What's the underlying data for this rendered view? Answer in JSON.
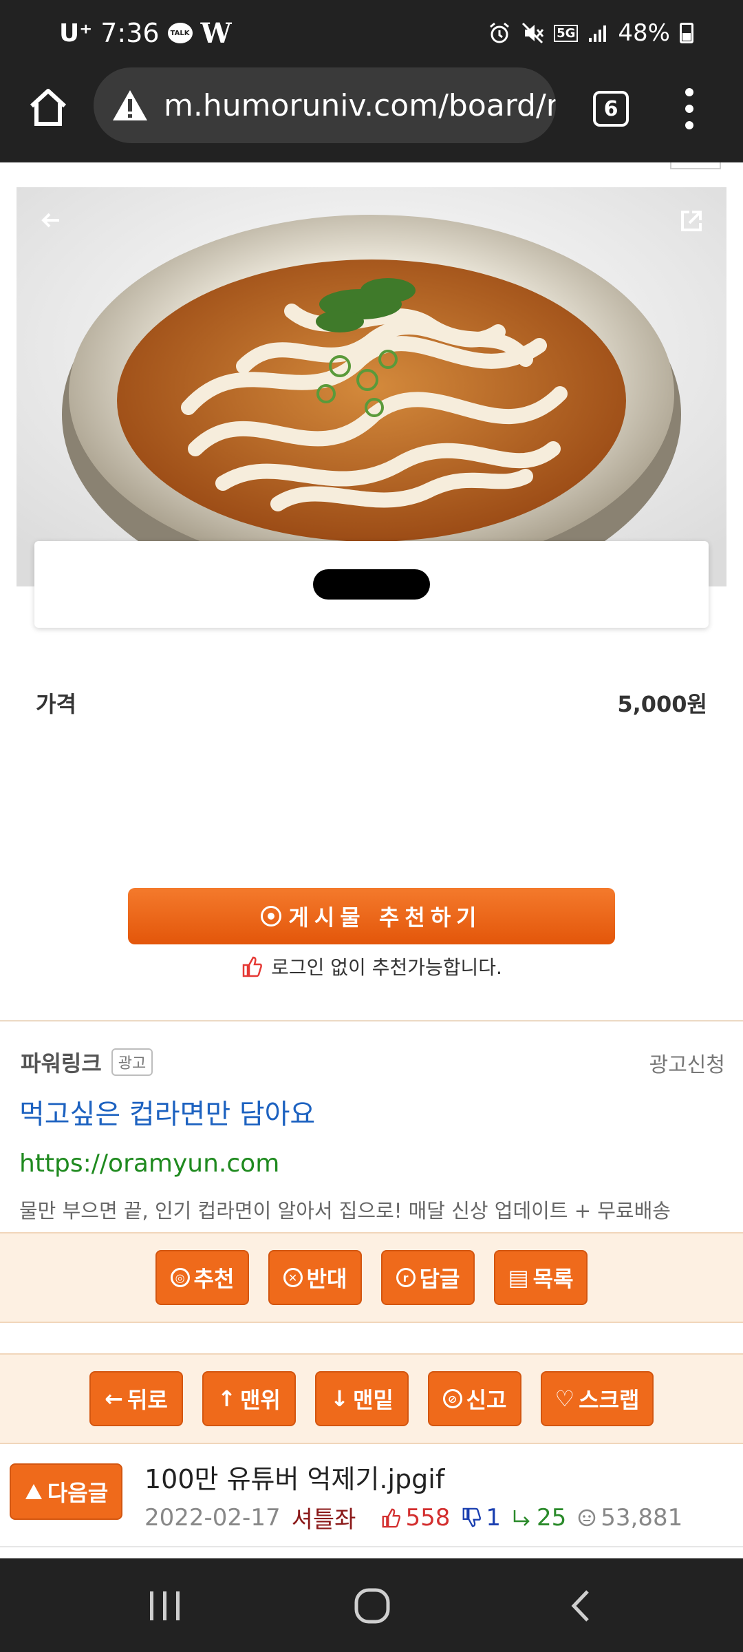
{
  "status_bar": {
    "carrier": "U⁺",
    "time": "7:36",
    "talk_badge": "TALK",
    "w_badge": "W",
    "network": "5G",
    "battery": "48%"
  },
  "browser": {
    "url": "m.humoruniv.com/board/re",
    "tab_count": "6"
  },
  "product": {
    "price_label": "가격",
    "price_value": "5,000원"
  },
  "recommend": {
    "button_label": "게시물  추천하기",
    "note": "로그인 없이 추천가능합니다."
  },
  "ad": {
    "label": "파워링크",
    "badge": "광고",
    "apply": "광고신청",
    "title": "먹고싶은 컵라면만 담아요",
    "url": "https://oramyun.com",
    "description": "물만 부으면 끝, 인기 컵라면이 알아서 집으로! 매달 신상 업데이트 + 무료배송"
  },
  "actions": [
    {
      "icon": "◎",
      "label": "추천"
    },
    {
      "icon": "✕",
      "label": "반대"
    },
    {
      "icon": "r",
      "label": "답글"
    },
    {
      "icon": "▤",
      "label": "목록"
    }
  ],
  "nav_actions": [
    {
      "icon": "←",
      "label": "뒤로"
    },
    {
      "icon": "↑",
      "label": "맨위"
    },
    {
      "icon": "↓",
      "label": "맨밑"
    },
    {
      "icon": "⊘",
      "label": "신고"
    },
    {
      "icon": "♡",
      "label": "스크랩"
    }
  ],
  "next_post": {
    "button_label": "다음글",
    "title": "100만 유튜버 억제기.jpgif",
    "date": "2022-02-17",
    "author": "셔틀좌",
    "up": "558",
    "down": "1",
    "replies": "25",
    "views": "53,881"
  }
}
